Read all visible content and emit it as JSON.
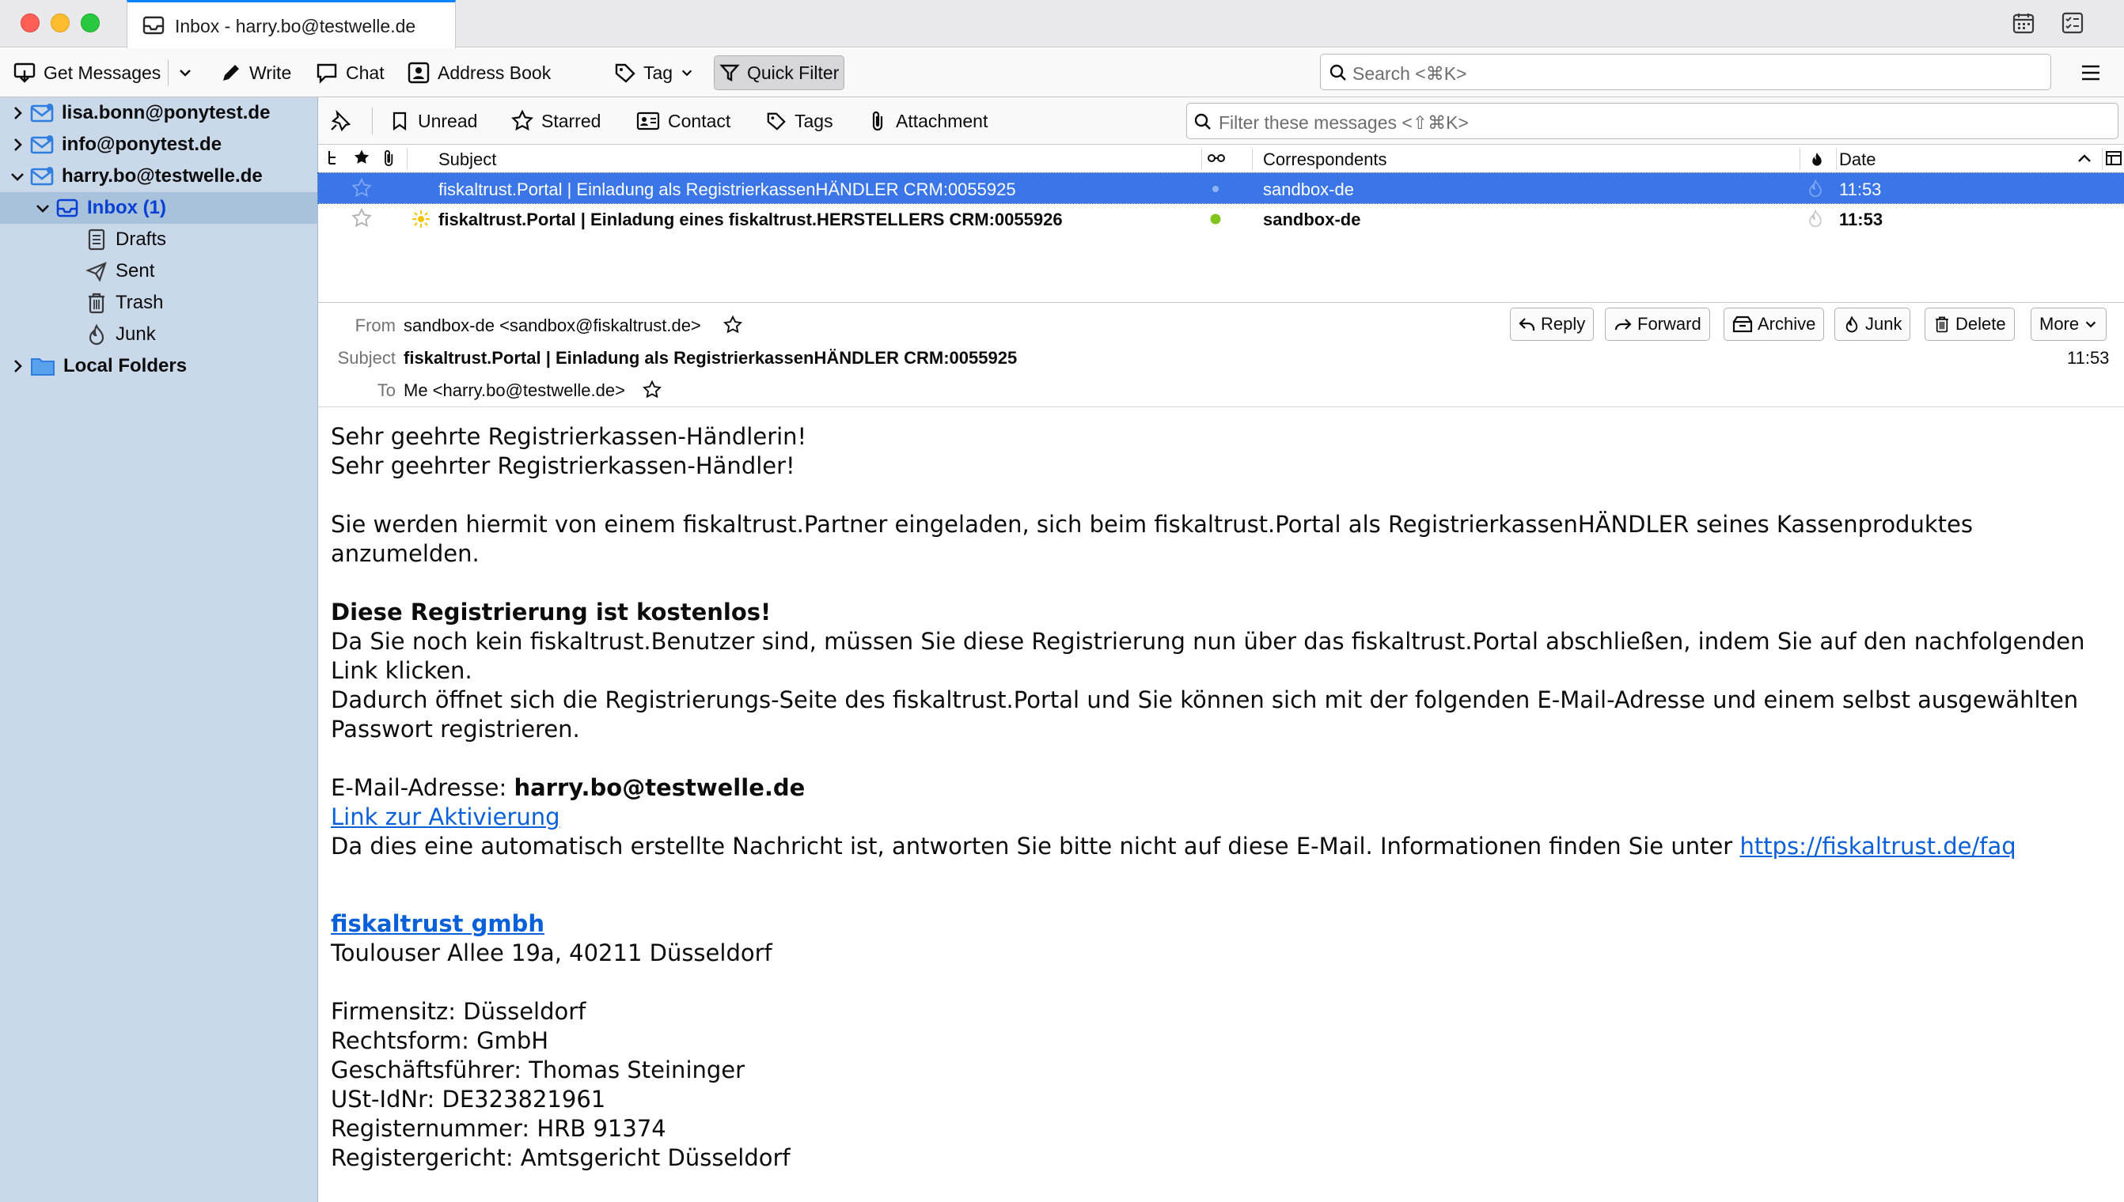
{
  "window": {
    "tab_title": "Inbox - harry.bo@testwelle.de"
  },
  "toolbar": {
    "get_messages": "Get Messages",
    "write": "Write",
    "chat": "Chat",
    "address_book": "Address Book",
    "tag": "Tag",
    "quick_filter": "Quick Filter",
    "search_placeholder": "Search <⌘K>"
  },
  "folders": {
    "accounts": [
      {
        "name": "lisa.bonn@ponytest.de"
      },
      {
        "name": "info@ponytest.de"
      },
      {
        "name": "harry.bo@testwelle.de"
      }
    ],
    "inbox": "Inbox (1)",
    "drafts": "Drafts",
    "sent": "Sent",
    "trash": "Trash",
    "junk": "Junk",
    "local_folders": "Local Folders"
  },
  "quickfilter": {
    "unread": "Unread",
    "starred": "Starred",
    "contact": "Contact",
    "tags": "Tags",
    "attachment": "Attachment",
    "filter_placeholder": "Filter these messages <⇧⌘K>"
  },
  "thread_columns": {
    "subject": "Subject",
    "correspondents": "Correspondents",
    "date": "Date"
  },
  "messages": [
    {
      "subject": "fiskaltrust.Portal | Einladung als RegistrierkassenHÄNDLER CRM:0055925",
      "correspondent": "sandbox-de",
      "date": "11:53",
      "selected": true,
      "unread": false
    },
    {
      "subject": "fiskaltrust.Portal | Einladung eines fiskaltrust.HERSTELLERS CRM:0055926",
      "correspondent": "sandbox-de",
      "date": "11:53",
      "selected": false,
      "unread": true
    }
  ],
  "message_header": {
    "from_label": "From",
    "from_value": "sandbox-de <sandbox@fiskaltrust.de>",
    "subject_label": "Subject",
    "subject_value": "fiskaltrust.Portal | Einladung als RegistrierkassenHÄNDLER CRM:0055925",
    "to_label": "To",
    "to_value": "Me <harry.bo@testwelle.de>",
    "time": "11:53",
    "reply": "Reply",
    "forward": "Forward",
    "archive": "Archive",
    "junk": "Junk",
    "delete": "Delete",
    "more": "More"
  },
  "body": {
    "greeting_1": "Sehr geehrte Registrierkassen-Händlerin!",
    "greeting_2": "Sehr geehrter Registrierkassen-Händler!",
    "intro": "Sie werden hiermit von einem fiskaltrust.Partner eingeladen, sich beim fiskaltrust.Portal als RegistrierkassenHÄNDLER seines Kassenproduktes anzumelden.",
    "free_heading": "Diese Registrierung ist kostenlos!",
    "para_1": "Da Sie noch kein fiskaltrust.Benutzer sind, müssen Sie diese Registrierung nun über das fiskaltrust.Portal abschließen, indem Sie auf den nachfolgenden Link klicken.",
    "para_2": "Dadurch öffnet sich die Registrierungs-Seite des fiskaltrust.Portal und Sie können sich mit der folgenden E-Mail-Adresse und einem selbst ausgewählten Passwort registrieren.",
    "email_label": "E-Mail-Adresse: ",
    "email_value": "harry.bo@testwelle.de",
    "activation_link": "Link zur Aktivierung",
    "auto_note": "Da dies eine automatisch erstellte Nachricht ist, antworten Sie bitte nicht auf diese E-Mail. Informationen finden Sie unter ",
    "faq_link": "https://fiskaltrust.de/faq",
    "company_link": "fiskaltrust gmbh",
    "address": "Toulouser Allee 19a, 40211 Düsseldorf",
    "seat": "Firmensitz: Düsseldorf",
    "legal_form": "Rechtsform: GmbH",
    "ceo": "Geschäftsführer: Thomas Steininger",
    "vat": "USt-IdNr: DE323821961",
    "register_no": "Registernummer: HRB 91374",
    "court": "Registergericht: Amtsgericht Düsseldorf"
  },
  "colors": {
    "selection": "#3b76e8",
    "folder_pane": "#cad9ea",
    "link": "#0a60d8",
    "unread_dot": "#7fc51d"
  }
}
